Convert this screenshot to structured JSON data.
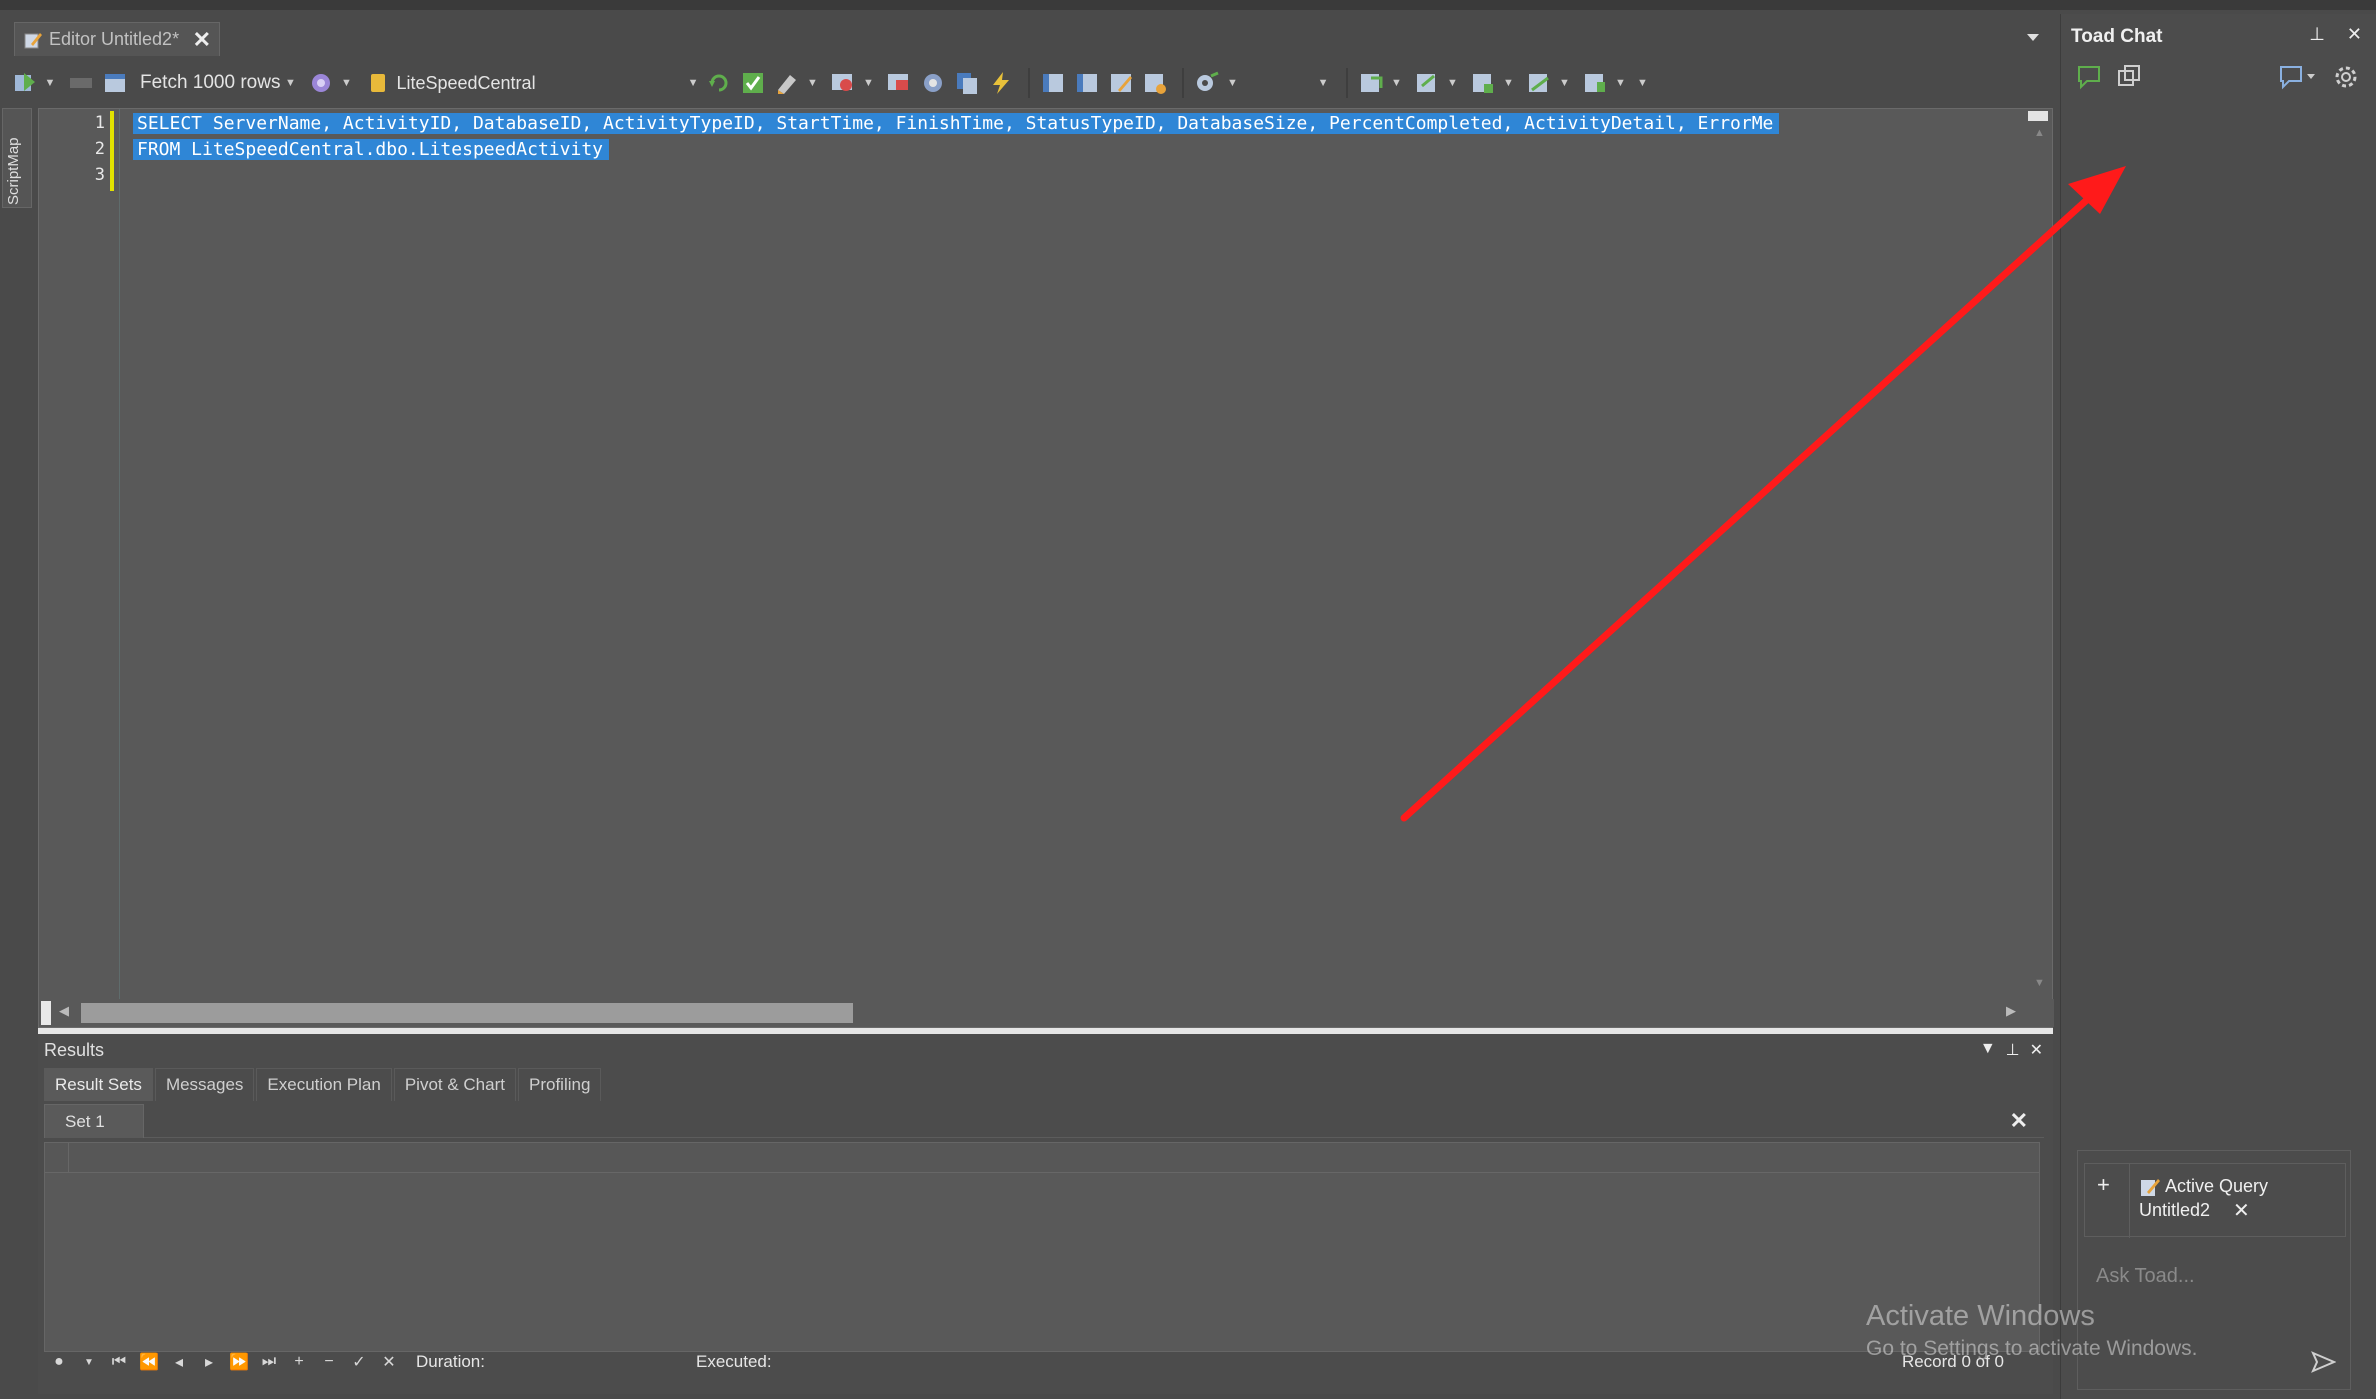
{
  "tab": {
    "label": "Editor Untitled2*",
    "close": "✕"
  },
  "toolbar": {
    "fetch_label": "Fetch 1000 rows",
    "connection": "LiteSpeedCentral"
  },
  "scriptmap_label": "ScriptMap",
  "editor": {
    "line_numbers": [
      "1",
      "2",
      "3"
    ],
    "lines": [
      "SELECT ServerName, ActivityID, DatabaseID, ActivityTypeID, StartTime, FinishTime, StatusTypeID, DatabaseSize, PercentCompleted, ActivityDetail, ErrorMe",
      "FROM LiteSpeedCentral.dbo.LitespeedActivity",
      ""
    ]
  },
  "results": {
    "title": "Results",
    "tabs": [
      "Result Sets",
      "Messages",
      "Execution Plan",
      "Pivot & Chart",
      "Profiling"
    ],
    "set_tab": "Set 1",
    "duration_label": "Duration:",
    "executed_label": "Executed:",
    "record_text": "Record 0 of 0"
  },
  "chat": {
    "title": "Toad Chat",
    "context_title": "Active Query",
    "context_name": "Untitled2",
    "placeholder": "Ask Toad..."
  },
  "watermark": {
    "line1": "Activate Windows",
    "line2": "Go to Settings to activate Windows."
  },
  "colors": {
    "selection": "#2f86d6",
    "modified_bar": "#e2e200",
    "annotation_arrow": "#ff1a1a"
  }
}
